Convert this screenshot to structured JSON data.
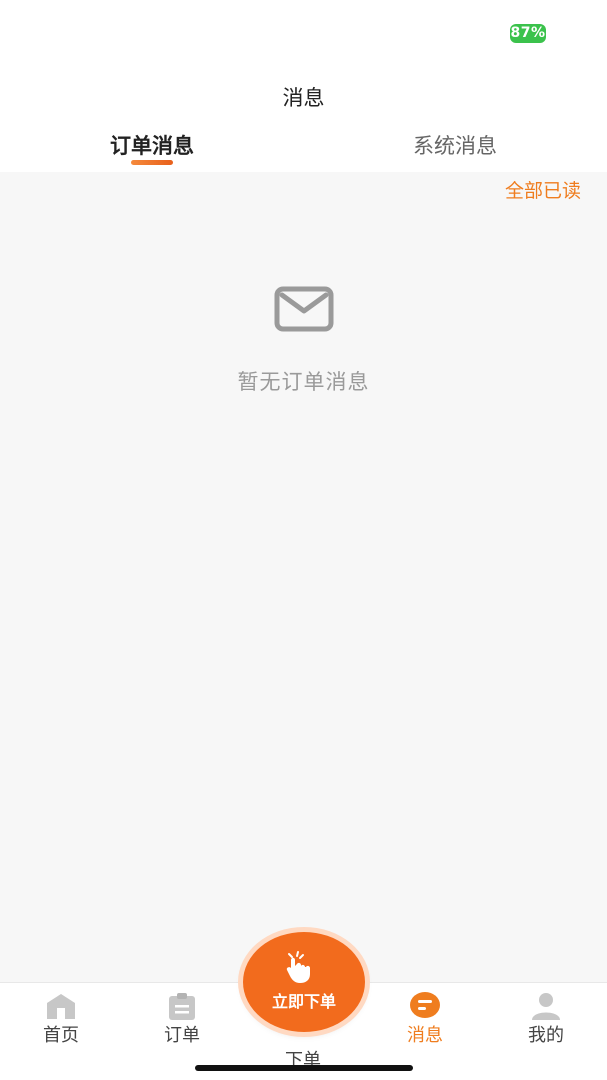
{
  "status_bar": {
    "battery": "87%"
  },
  "header": {
    "title": "消息"
  },
  "tabs": [
    {
      "label": "订单消息",
      "active": true
    },
    {
      "label": "系统消息",
      "active": false
    }
  ],
  "actions": {
    "mark_all_read": "全部已读"
  },
  "empty_state": {
    "icon": "mail-icon",
    "text": "暂无订单消息"
  },
  "bottom_nav": {
    "items": [
      {
        "label": "首页",
        "icon": "home-icon",
        "active": false
      },
      {
        "label": "订单",
        "icon": "order-clipboard-icon",
        "active": false
      },
      {
        "label": "消息",
        "icon": "chat-bubble-icon",
        "active": true
      },
      {
        "label": "我的",
        "icon": "user-icon",
        "active": false
      }
    ],
    "center_button": {
      "label": "立即下单",
      "caption": "下单",
      "icon": "hand-tap-icon"
    }
  },
  "colors": {
    "accent": "#ef7d1f",
    "fab": "#f26b1d",
    "battery": "#3bc24c",
    "background": "#f7f7f7"
  }
}
